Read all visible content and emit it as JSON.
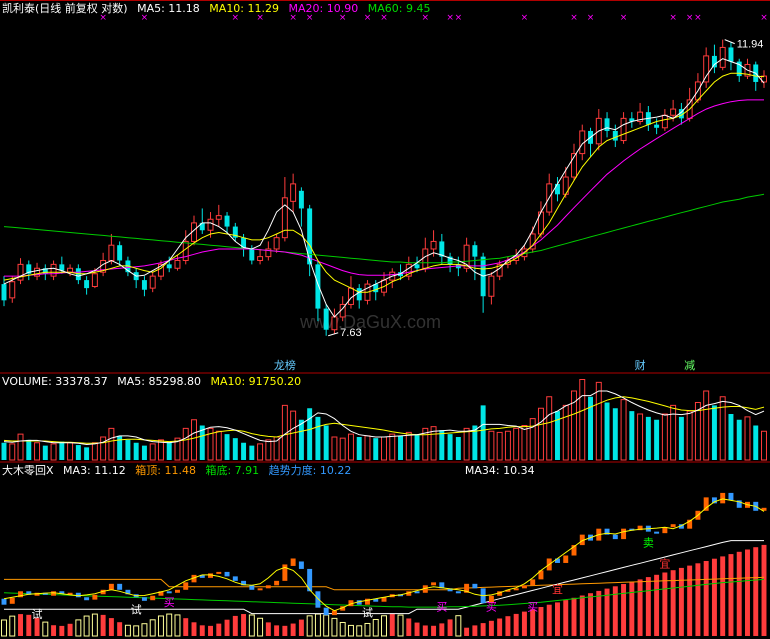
{
  "colors": {
    "up": "#ff3c3c",
    "down": "#00e6e6",
    "ma5": "#ffffff",
    "ma10": "#ffff00",
    "ma20": "#ff00ff",
    "ma60": "#00cc00",
    "grid": "#b00000",
    "orange": "#ff9900",
    "label": "#ffffff",
    "blue": "#3399ff"
  },
  "main_header": {
    "title": "凯利泰(日线 前复权 对数)",
    "ma5": "MA5: 11.18",
    "ma10": "MA10: 11.29",
    "ma20": "MA20: 10.90",
    "ma60": "MA60: 9.45"
  },
  "vol_header": {
    "title": "VOLUME: 33378.37",
    "ma5": "MA5: 85298.80",
    "ma10": "MA10: 91750.20"
  },
  "ind_header": {
    "title": "大木零回X",
    "ma3": "MA3: 11.12",
    "top": "箱顶: 11.48",
    "bottom": "箱底: 7.91",
    "trend": "趋势力度: 10.22",
    "ma34": "MA34: 10.34"
  },
  "annotations": {
    "high": "11.94",
    "low": "7.63",
    "tag_left": "龙榜",
    "tag_cai": "财",
    "tag_jian": "减",
    "sell": "卖",
    "buy": "买",
    "try": "试",
    "wait": "宜"
  },
  "watermark": "www.DaGuX.com",
  "chart_data": [
    {
      "type": "candlestick",
      "title": "凯利泰(日线 前复权 对数)",
      "scale": "log",
      "ylim": [
        7.3,
        12.3
      ],
      "high_label": 11.94,
      "low_label": 7.63,
      "candles": [
        [
          8.25,
          8.05,
          8.35,
          7.98
        ],
        [
          8.08,
          8.28,
          8.35,
          8.02
        ],
        [
          8.3,
          8.5,
          8.58,
          8.25
        ],
        [
          8.5,
          8.38,
          8.55,
          8.3
        ],
        [
          8.35,
          8.45,
          8.52,
          8.3
        ],
        [
          8.45,
          8.38,
          8.5,
          8.3
        ],
        [
          8.35,
          8.5,
          8.55,
          8.3
        ],
        [
          8.5,
          8.42,
          8.6,
          8.38
        ],
        [
          8.4,
          8.45,
          8.5,
          8.35
        ],
        [
          8.45,
          8.3,
          8.5,
          8.25
        ],
        [
          8.3,
          8.2,
          8.35,
          8.12
        ],
        [
          8.22,
          8.38,
          8.45,
          8.2
        ],
        [
          8.4,
          8.55,
          8.65,
          8.35
        ],
        [
          8.55,
          8.75,
          8.9,
          8.5
        ],
        [
          8.75,
          8.55,
          8.8,
          8.48
        ],
        [
          8.55,
          8.4,
          8.6,
          8.35
        ],
        [
          8.4,
          8.3,
          8.45,
          8.2
        ],
        [
          8.3,
          8.18,
          8.35,
          8.1
        ],
        [
          8.2,
          8.35,
          8.4,
          8.15
        ],
        [
          8.35,
          8.5,
          8.55,
          8.3
        ],
        [
          8.5,
          8.45,
          8.6,
          8.4
        ],
        [
          8.45,
          8.55,
          8.62,
          8.42
        ],
        [
          8.55,
          8.8,
          8.95,
          8.5
        ],
        [
          8.8,
          9.05,
          9.15,
          8.75
        ],
        [
          9.05,
          8.95,
          9.25,
          8.9
        ],
        [
          8.95,
          9.1,
          9.2,
          8.85
        ],
        [
          9.1,
          9.15,
          9.3,
          9.0
        ],
        [
          9.15,
          9.0,
          9.2,
          8.9
        ],
        [
          9.0,
          8.85,
          9.05,
          8.8
        ],
        [
          8.85,
          8.7,
          8.9,
          8.6
        ],
        [
          8.7,
          8.55,
          8.75,
          8.5
        ],
        [
          8.55,
          8.6,
          8.7,
          8.5
        ],
        [
          8.6,
          8.7,
          8.8,
          8.55
        ],
        [
          8.7,
          8.85,
          8.9,
          8.65
        ],
        [
          8.85,
          9.4,
          9.7,
          8.8
        ],
        [
          9.35,
          9.6,
          9.75,
          9.2
        ],
        [
          9.5,
          9.25,
          9.55,
          9.0
        ],
        [
          9.25,
          8.5,
          9.3,
          8.35
        ],
        [
          8.5,
          7.95,
          8.55,
          7.8
        ],
        [
          7.95,
          7.7,
          8.0,
          7.63
        ],
        [
          7.7,
          7.85,
          7.95,
          7.65
        ],
        [
          7.85,
          8.0,
          8.1,
          7.8
        ],
        [
          8.0,
          8.2,
          8.35,
          7.95
        ],
        [
          8.2,
          8.05,
          8.25,
          7.95
        ],
        [
          8.05,
          8.25,
          8.3,
          8.0
        ],
        [
          8.25,
          8.15,
          8.3,
          8.05
        ],
        [
          8.15,
          8.3,
          8.4,
          8.1
        ],
        [
          8.3,
          8.4,
          8.45,
          8.2
        ],
        [
          8.4,
          8.35,
          8.5,
          8.3
        ],
        [
          8.35,
          8.5,
          8.6,
          8.3
        ],
        [
          8.5,
          8.45,
          8.6,
          8.4
        ],
        [
          8.45,
          8.7,
          8.85,
          8.4
        ],
        [
          8.7,
          8.8,
          8.95,
          8.6
        ],
        [
          8.8,
          8.6,
          8.9,
          8.5
        ],
        [
          8.6,
          8.5,
          8.65,
          8.4
        ],
        [
          8.5,
          8.45,
          8.6,
          8.35
        ],
        [
          8.45,
          8.75,
          8.85,
          8.4
        ],
        [
          8.75,
          8.6,
          8.8,
          8.3
        ],
        [
          8.6,
          8.1,
          8.65,
          7.9
        ],
        [
          8.1,
          8.35,
          8.4,
          8.0
        ],
        [
          8.35,
          8.5,
          8.55,
          8.3
        ],
        [
          8.5,
          8.55,
          8.6,
          8.45
        ],
        [
          8.55,
          8.6,
          8.7,
          8.5
        ],
        [
          8.6,
          8.7,
          8.75,
          8.55
        ],
        [
          8.7,
          8.9,
          9.0,
          8.65
        ],
        [
          8.9,
          9.2,
          9.35,
          8.85
        ],
        [
          9.2,
          9.6,
          9.75,
          9.15
        ],
        [
          9.6,
          9.45,
          9.7,
          9.35
        ],
        [
          9.45,
          9.7,
          9.85,
          9.4
        ],
        [
          9.7,
          10.05,
          10.2,
          9.65
        ],
        [
          10.05,
          10.4,
          10.5,
          9.95
        ],
        [
          10.4,
          10.2,
          10.45,
          10.0
        ],
        [
          10.2,
          10.6,
          10.75,
          10.1
        ],
        [
          10.6,
          10.4,
          10.7,
          10.3
        ],
        [
          10.4,
          10.25,
          10.5,
          10.15
        ],
        [
          10.25,
          10.6,
          10.7,
          10.2
        ],
        [
          10.6,
          10.55,
          10.7,
          10.45
        ],
        [
          10.55,
          10.7,
          10.85,
          10.5
        ],
        [
          10.7,
          10.5,
          10.8,
          10.4
        ],
        [
          10.5,
          10.45,
          10.6,
          10.35
        ],
        [
          10.45,
          10.65,
          10.75,
          10.4
        ],
        [
          10.65,
          10.75,
          10.9,
          10.55
        ],
        [
          10.75,
          10.6,
          10.85,
          10.5
        ],
        [
          10.6,
          10.9,
          11.1,
          10.55
        ],
        [
          10.9,
          11.2,
          11.35,
          10.85
        ],
        [
          11.2,
          11.65,
          11.8,
          11.1
        ],
        [
          11.65,
          11.45,
          11.85,
          11.35
        ],
        [
          11.45,
          11.8,
          11.94,
          11.4
        ],
        [
          11.8,
          11.55,
          11.9,
          11.4
        ],
        [
          11.55,
          11.3,
          11.6,
          11.2
        ],
        [
          11.3,
          11.5,
          11.6,
          11.25
        ],
        [
          11.5,
          11.2,
          11.55,
          11.05
        ],
        [
          11.2,
          11.3,
          11.4,
          11.1
        ]
      ],
      "ma5": [
        8.25,
        8.3,
        8.35,
        8.4,
        8.42,
        8.44,
        8.45,
        8.42,
        8.38,
        8.35,
        8.38,
        8.42,
        8.5,
        8.55,
        8.5,
        8.42,
        8.35,
        8.36,
        8.42,
        8.48,
        8.55,
        8.7,
        8.85,
        8.95,
        9.05,
        9.05,
        9.0,
        8.92,
        8.8,
        8.72,
        8.7,
        8.75,
        8.95,
        9.2,
        9.3,
        9.2,
        8.95,
        8.55,
        8.25,
        8.0,
        7.85,
        7.95,
        8.08,
        8.15,
        8.2,
        8.25,
        8.3,
        8.35,
        8.38,
        8.45,
        8.52,
        8.6,
        8.65,
        8.62,
        8.58,
        8.55,
        8.5,
        8.4,
        8.35,
        8.38,
        8.45,
        8.55,
        8.62,
        8.75,
        8.95,
        9.2,
        9.4,
        9.6,
        9.8,
        10.0,
        10.2,
        10.3,
        10.4,
        10.45,
        10.42,
        10.5,
        10.55,
        10.58,
        10.6,
        10.62,
        10.65,
        10.6,
        10.7,
        10.85,
        11.05,
        11.3,
        11.5,
        11.6,
        11.55,
        11.5,
        11.4,
        11.35,
        11.18
      ],
      "ma10": [
        8.3,
        8.32,
        8.34,
        8.36,
        8.38,
        8.4,
        8.4,
        8.4,
        8.4,
        8.38,
        8.38,
        8.4,
        8.42,
        8.45,
        8.48,
        8.48,
        8.45,
        8.42,
        8.4,
        8.45,
        8.55,
        8.62,
        8.7,
        8.78,
        8.85,
        8.9,
        8.92,
        8.9,
        8.88,
        8.85,
        8.82,
        8.82,
        8.85,
        8.9,
        8.95,
        8.95,
        8.88,
        8.75,
        8.55,
        8.4,
        8.3,
        8.25,
        8.2,
        8.15,
        8.15,
        8.18,
        8.22,
        8.28,
        8.32,
        8.38,
        8.42,
        8.45,
        8.48,
        8.5,
        8.5,
        8.5,
        8.48,
        8.45,
        8.44,
        8.45,
        8.48,
        8.52,
        8.58,
        8.65,
        8.75,
        8.9,
        9.05,
        9.25,
        9.45,
        9.65,
        9.85,
        10.0,
        10.15,
        10.25,
        10.3,
        10.35,
        10.4,
        10.45,
        10.5,
        10.55,
        10.58,
        10.6,
        10.65,
        10.75,
        10.9,
        11.05,
        11.2,
        11.3,
        11.35,
        11.35,
        11.33,
        11.3,
        11.29
      ],
      "ma20": [
        8.35,
        8.35,
        8.35,
        8.36,
        8.37,
        8.38,
        8.38,
        8.39,
        8.4,
        8.4,
        8.41,
        8.42,
        8.43,
        8.44,
        8.45,
        8.46,
        8.47,
        8.48,
        8.5,
        8.52,
        8.55,
        8.58,
        8.6,
        8.63,
        8.66,
        8.68,
        8.7,
        8.7,
        8.7,
        8.7,
        8.7,
        8.69,
        8.68,
        8.67,
        8.66,
        8.64,
        8.62,
        8.58,
        8.54,
        8.5,
        8.46,
        8.42,
        8.39,
        8.37,
        8.36,
        8.36,
        8.36,
        8.37,
        8.38,
        8.4,
        8.42,
        8.44,
        8.45,
        8.46,
        8.47,
        8.48,
        8.48,
        8.48,
        8.48,
        8.5,
        8.52,
        8.56,
        8.6,
        8.66,
        8.74,
        8.82,
        8.92,
        9.02,
        9.14,
        9.26,
        9.38,
        9.5,
        9.62,
        9.74,
        9.84,
        9.94,
        10.03,
        10.12,
        10.2,
        10.28,
        10.36,
        10.44,
        10.52,
        10.6,
        10.68,
        10.75,
        10.8,
        10.84,
        10.87,
        10.89,
        10.9,
        10.9,
        10.9
      ],
      "ma60": [
        9.0,
        8.99,
        8.98,
        8.97,
        8.96,
        8.95,
        8.94,
        8.93,
        8.92,
        8.91,
        8.9,
        8.89,
        8.88,
        8.87,
        8.86,
        8.85,
        8.84,
        8.83,
        8.82,
        8.81,
        8.8,
        8.79,
        8.78,
        8.77,
        8.76,
        8.75,
        8.74,
        8.73,
        8.72,
        8.71,
        8.7,
        8.69,
        8.68,
        8.67,
        8.66,
        8.65,
        8.64,
        8.63,
        8.62,
        8.61,
        8.6,
        8.59,
        8.58,
        8.57,
        8.56,
        8.55,
        8.54,
        8.53,
        8.53,
        8.52,
        8.52,
        8.52,
        8.52,
        8.52,
        8.53,
        8.53,
        8.54,
        8.55,
        8.56,
        8.57,
        8.58,
        8.6,
        8.62,
        8.64,
        8.66,
        8.68,
        8.71,
        8.74,
        8.77,
        8.8,
        8.83,
        8.86,
        8.89,
        8.92,
        8.95,
        8.98,
        9.01,
        9.04,
        9.07,
        9.1,
        9.13,
        9.16,
        9.19,
        9.22,
        9.25,
        9.28,
        9.31,
        9.34,
        9.36,
        9.38,
        9.41,
        9.43,
        9.45
      ]
    },
    {
      "type": "bar",
      "title": "VOLUME",
      "ylim": [
        0,
        120000
      ],
      "values": [
        30,
        28,
        45,
        35,
        30,
        25,
        28,
        32,
        30,
        26,
        22,
        30,
        40,
        55,
        42,
        35,
        30,
        25,
        28,
        35,
        32,
        38,
        55,
        70,
        60,
        55,
        50,
        45,
        38,
        30,
        25,
        28,
        35,
        40,
        95,
        85,
        70,
        90,
        75,
        60,
        40,
        38,
        45,
        40,
        42,
        38,
        40,
        45,
        42,
        48,
        45,
        55,
        58,
        52,
        45,
        40,
        55,
        60,
        95,
        50,
        48,
        50,
        55,
        60,
        72,
        90,
        110,
        85,
        95,
        120,
        140,
        110,
        135,
        100,
        90,
        105,
        85,
        80,
        75,
        70,
        80,
        95,
        75,
        85,
        100,
        120,
        95,
        110,
        80,
        70,
        75,
        60,
        50
      ],
      "ma5": [
        32,
        31,
        33,
        34,
        34,
        32,
        30,
        30,
        30,
        29,
        27,
        28,
        31,
        38,
        42,
        42,
        40,
        35,
        32,
        31,
        30,
        32,
        38,
        47,
        52,
        57,
        58,
        56,
        52,
        46,
        40,
        34,
        32,
        33,
        45,
        55,
        63,
        72,
        82,
        80,
        72,
        60,
        50,
        44,
        42,
        40,
        40,
        41,
        42,
        43,
        44,
        47,
        50,
        51,
        52,
        50,
        50,
        52,
        62,
        62,
        62,
        60,
        59,
        53,
        57,
        66,
        79,
        85,
        94,
        100,
        112,
        112,
        120,
        120,
        115,
        108,
        100,
        93,
        87,
        82,
        78,
        80,
        79,
        81,
        87,
        95,
        98,
        102,
        100,
        95,
        86,
        79,
        85
      ],
      "ma10": [
        34,
        33,
        33,
        33,
        33,
        33,
        32,
        31,
        31,
        30,
        29,
        29,
        30,
        33,
        35,
        36,
        36,
        35,
        34,
        33,
        32,
        33,
        35,
        38,
        42,
        46,
        49,
        51,
        52,
        50,
        46,
        43,
        41,
        40,
        44,
        47,
        50,
        53,
        58,
        62,
        64,
        62,
        60,
        58,
        56,
        54,
        52,
        49,
        47,
        45,
        44,
        44,
        45,
        46,
        47,
        48,
        49,
        50,
        52,
        54,
        55,
        57,
        58,
        58,
        59,
        62,
        65,
        70,
        75,
        80,
        86,
        92,
        98,
        104,
        108,
        110,
        108,
        105,
        102,
        98,
        94,
        90,
        87,
        86,
        86,
        88,
        90,
        92,
        93,
        93,
        91,
        88,
        92
      ]
    },
    {
      "type": "line",
      "title": "大木零回X",
      "ylim": [
        7.0,
        12.3
      ],
      "ma3_label": 11.12,
      "box_top_label": 11.48,
      "box_bottom_label": 7.91,
      "trend_label": 10.22,
      "ma34_label": 10.34
    }
  ]
}
